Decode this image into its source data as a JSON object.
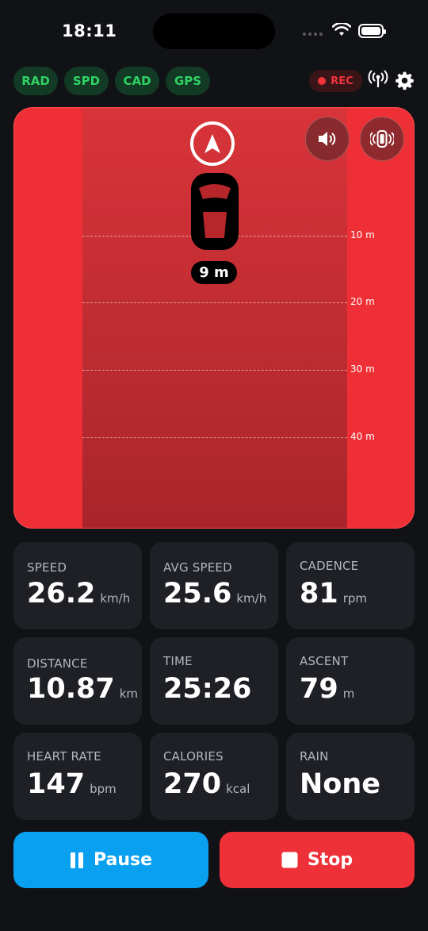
{
  "status_bar": {
    "time": "18:11"
  },
  "sensors": [
    "RAD",
    "SPD",
    "CAD",
    "GPS"
  ],
  "recording": {
    "label": "REC"
  },
  "radar": {
    "distance_marks": [
      "10 m",
      "20 m",
      "30 m",
      "40 m"
    ],
    "vehicle_distance": "9 m"
  },
  "metrics": [
    {
      "label": "SPEED",
      "value": "26.2",
      "unit": "km/h"
    },
    {
      "label": "AVG SPEED",
      "value": "25.6",
      "unit": "km/h"
    },
    {
      "label": "CADENCE",
      "value": "81",
      "unit": "rpm"
    },
    {
      "label": "DISTANCE",
      "value": "10.87",
      "unit": "km"
    },
    {
      "label": "TIME",
      "value": "25:26",
      "unit": ""
    },
    {
      "label": "ASCENT",
      "value": "79",
      "unit": "m"
    },
    {
      "label": "HEART RATE",
      "value": "147",
      "unit": "bpm"
    },
    {
      "label": "CALORIES",
      "value": "270",
      "unit": "kcal"
    },
    {
      "label": "RAIN",
      "value": "None",
      "unit": ""
    }
  ],
  "actions": {
    "pause": "Pause",
    "stop": "Stop"
  },
  "colors": {
    "sensor_ok": "#31d264",
    "alert": "#ee3036",
    "pause": "#0aa0f0",
    "stop": "#ee3038"
  },
  "icons": [
    "wifi-icon",
    "battery-icon",
    "signal-icon",
    "gear-icon",
    "navigation-arrow-icon",
    "speaker-icon",
    "watch-vibrate-icon",
    "car-icon",
    "pause-icon",
    "stop-icon"
  ]
}
